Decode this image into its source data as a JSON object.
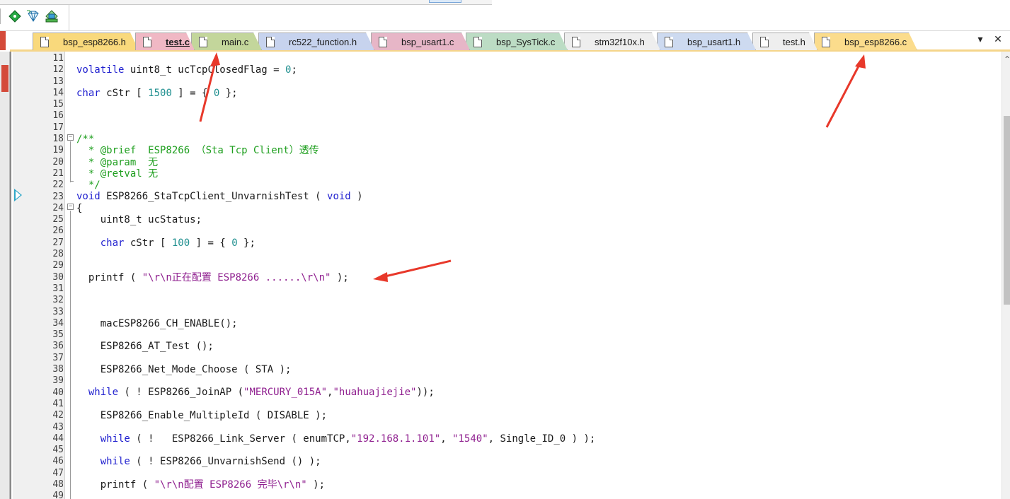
{
  "toolbar": {
    "buttons": [
      {
        "name": "diamond-green-icon"
      },
      {
        "name": "diamond-outline-icon"
      },
      {
        "name": "component-icon"
      }
    ]
  },
  "tabs": [
    {
      "label": "bsp_esp8266.h",
      "color": "#f9d97c",
      "active": false
    },
    {
      "label": "test.c",
      "color": "#f0b8c4",
      "active": true
    },
    {
      "label": "main.c",
      "color": "#c3d69b",
      "active": false
    },
    {
      "label": "rc522_function.h",
      "color": "#c7d3ee",
      "active": false
    },
    {
      "label": "bsp_usart1.c",
      "color": "#e7b6c7",
      "active": false
    },
    {
      "label": "bsp_SysTick.c",
      "color": "#bcdcc4",
      "active": false
    },
    {
      "label": "stm32f10x.h",
      "color": "#eeeeee",
      "active": false
    },
    {
      "label": "bsp_usart1.h",
      "color": "#cddaf0",
      "active": false
    },
    {
      "label": "test.h",
      "color": "#eeeeee",
      "active": false
    },
    {
      "label": "bsp_esp8266.c",
      "color": "#fbdc8c",
      "active": false
    }
  ],
  "tab_controls": {
    "dropdown": "▾",
    "close": "✕"
  },
  "line_numbers": [
    "11",
    "12",
    "13",
    "14",
    "15",
    "16",
    "17",
    "18",
    "19",
    "20",
    "21",
    "22",
    "23",
    "24",
    "25",
    "26",
    "27",
    "28",
    "29",
    "30",
    "31",
    "32",
    "33",
    "34",
    "35",
    "36",
    "37",
    "38",
    "39",
    "40",
    "41",
    "42",
    "43",
    "44",
    "45",
    "46",
    "47",
    "48",
    "49"
  ],
  "code": {
    "l12": {
      "kw": "volatile",
      "a": " uint8_t ucTcpClosedFlag = ",
      "num": "0",
      "b": ";"
    },
    "l14": {
      "kw": "char",
      "a": " cStr [ ",
      "num": "1500",
      "b": " ] = { ",
      "num2": "0",
      "c": " };"
    },
    "l18": "/**",
    "l19": "  * @brief  ESP8266 （Sta Tcp Client）透传",
    "l20": "  * @param  无",
    "l21": "  * @retval 无",
    "l22": "  */",
    "l23": {
      "kw": "void",
      "a": " ESP8266_StaTcpClient_UnvarnishTest ( ",
      "kw2": "void",
      "b": " )"
    },
    "l24": "{",
    "l25": "    uint8_t ucStatus;",
    "l27": {
      "kw": "char",
      "a": " cStr [ ",
      "num": "100",
      "b": " ] = { ",
      "num2": "0",
      "c": " };"
    },
    "l30": {
      "a": "  printf ( ",
      "str": "\"\\r\\n正在配置 ESP8266 ......\\r\\n\"",
      "b": " );"
    },
    "l34": "    macESP8266_CH_ENABLE();",
    "l36": "    ESP8266_AT_Test ();",
    "l38": "    ESP8266_Net_Mode_Choose ( STA );",
    "l40": {
      "kw": "while",
      "a": " ( ! ESP8266_JoinAP (",
      "str": "\"MERCURY_015A\"",
      "b": ",",
      "str2": "\"huahuajiejie\"",
      "c": "));"
    },
    "l42": "    ESP8266_Enable_MultipleId ( DISABLE );",
    "l44": {
      "kw": "while",
      "a": " ( !   ESP8266_Link_Server ( enumTCP,",
      "str": "\"192.168.1.101\"",
      "b": ", ",
      "str2": "\"1540\"",
      "c": ", Single_ID_0 ) );"
    },
    "l46": {
      "kw": "while",
      "a": " ( ! ESP8266_UnvarnishSend () );"
    },
    "l48": {
      "a": "    printf ( ",
      "str": "\"\\r\\n配置 ESP8266 完毕\\r\\n\"",
      "b": " );"
    }
  },
  "colors": {
    "keyword": "#1f1fcf",
    "number": "#1f8f8f",
    "string": "#8f1f8f",
    "comment": "#1f9f1f",
    "arrow": "#e8382a"
  }
}
